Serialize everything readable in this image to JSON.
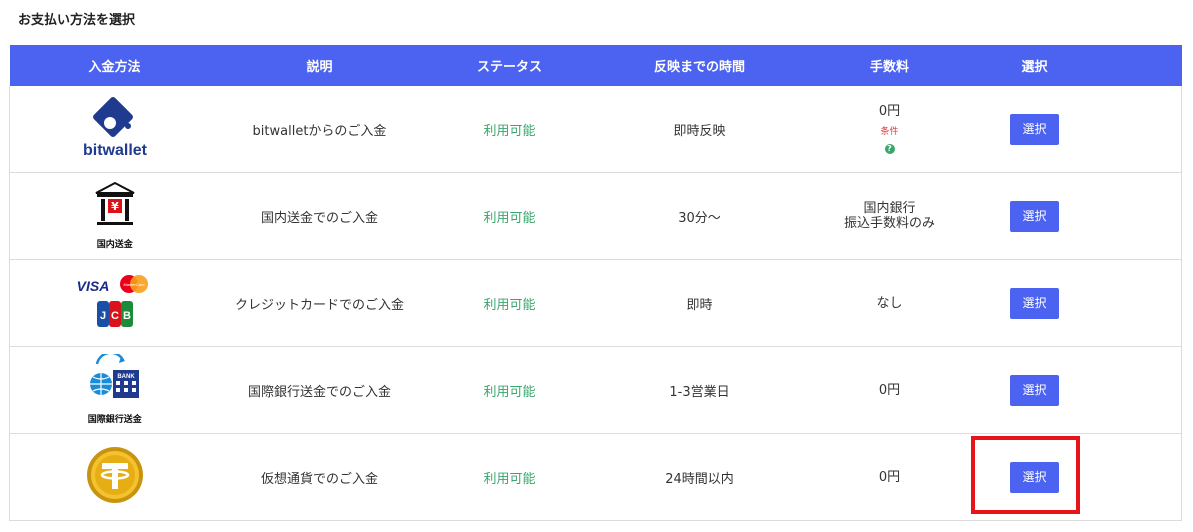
{
  "page": {
    "title": "お支払い方法を選択"
  },
  "table": {
    "headers": [
      "入金方法",
      "説明",
      "ステータス",
      "反映までの時間",
      "手数料",
      "選択"
    ],
    "rows": [
      {
        "logo": "bitwallet-logo",
        "logo_text": "bitwallet",
        "description": "bitwalletからのご入金",
        "status": "利用可能",
        "timing": "即時反映",
        "fee": "0円",
        "fee_condition": "条件",
        "fee_help": "?",
        "select_label": "選択"
      },
      {
        "logo": "domestic-bank-icon",
        "logo_text": "国内送金",
        "description": "国内送金でのご入金",
        "status": "利用可能",
        "timing": "30分～",
        "fee_line1": "国内銀行",
        "fee_line2": "振込手数料のみ",
        "select_label": "選択"
      },
      {
        "logo": "visa-mastercard-jcb-logos",
        "logo_visa": "VISA",
        "logo_mc": "MasterCard",
        "logo_jcb": "JCB",
        "description": "クレジットカードでのご入金",
        "status": "利用可能",
        "timing": "即時",
        "fee": "なし",
        "select_label": "選択"
      },
      {
        "logo": "international-bank-icon",
        "logo_bank": "BANK",
        "logo_text": "国際銀行送金",
        "description": "国際銀行送金でのご入金",
        "status": "利用可能",
        "timing": "1-3営業日",
        "fee": "0円",
        "select_label": "選択"
      },
      {
        "logo": "tether-coin-icon",
        "description": "仮想通貨でのご入金",
        "status": "利用可能",
        "timing": "24時間以内",
        "fee": "0円",
        "select_label": "選択"
      }
    ]
  },
  "colors": {
    "header_bg": "#4b63f0",
    "status_green": "#3aa56c",
    "button_bg": "#4b63f0",
    "highlight": "#e8141a",
    "condition_red": "#e03a3a"
  }
}
